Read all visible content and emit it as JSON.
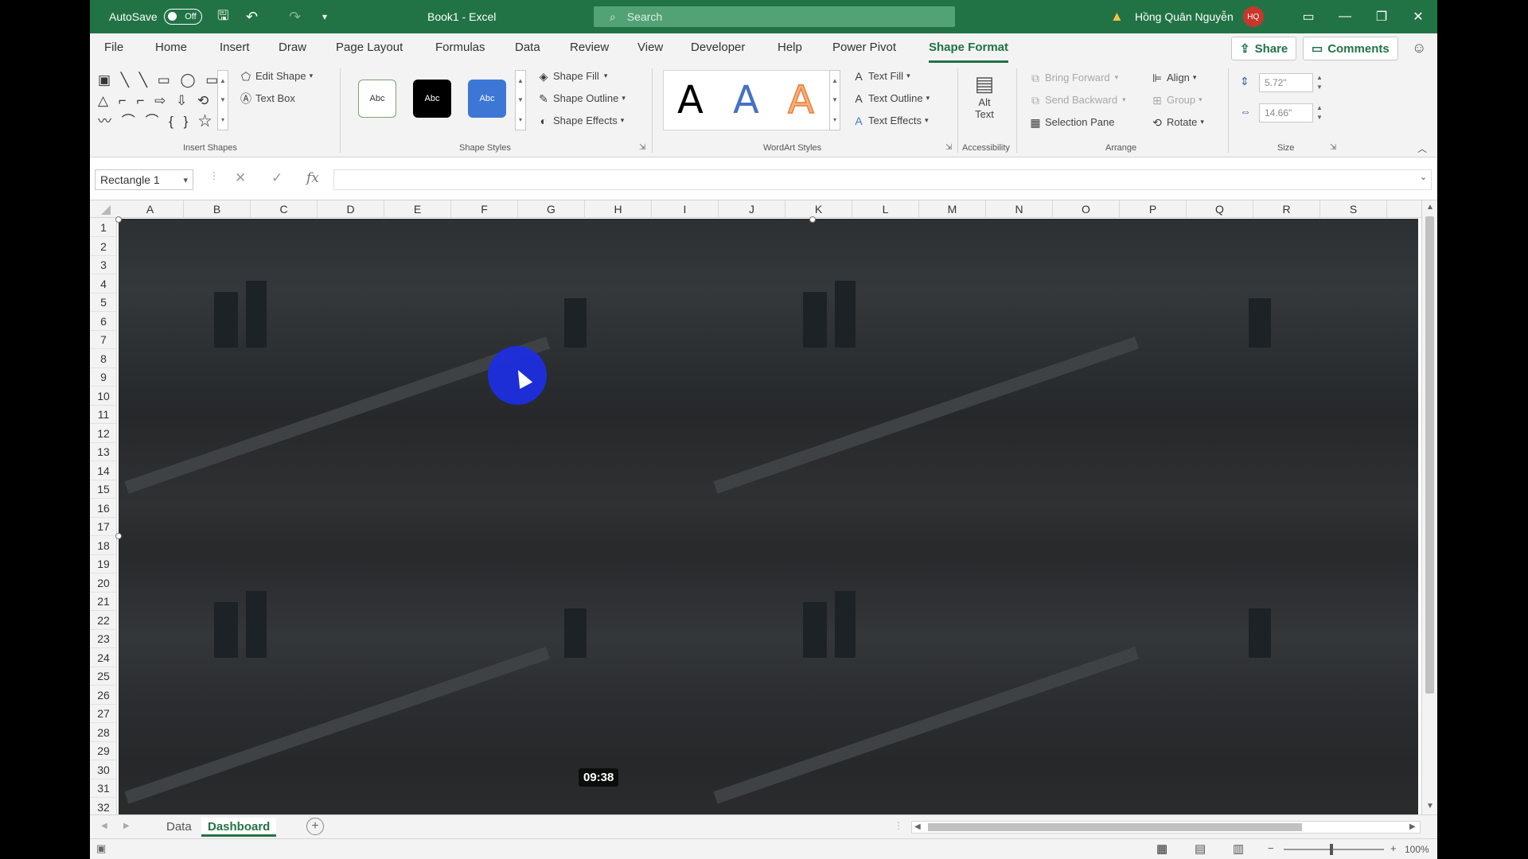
{
  "titlebar": {
    "autosave_label": "AutoSave",
    "autosave_state": "Off",
    "doc_title": "Book1 - Excel",
    "search_placeholder": "Search",
    "user_name": "Hồng Quân Nguyễn",
    "user_initials": "HQ"
  },
  "tabs": [
    "File",
    "Home",
    "Insert",
    "Draw",
    "Page Layout",
    "Formulas",
    "Data",
    "Review",
    "View",
    "Developer",
    "Help",
    "Power Pivot",
    "Shape Format"
  ],
  "active_tab": "Shape Format",
  "share_label": "Share",
  "comments_label": "Comments",
  "ribbon": {
    "insert_shapes": {
      "edit_shape": "Edit Shape",
      "text_box": "Text Box",
      "label": "Insert Shapes"
    },
    "shape_styles": {
      "sample": "Abc",
      "fill": "Shape Fill",
      "outline": "Shape Outline",
      "effects": "Shape Effects",
      "label": "Shape Styles"
    },
    "wordart": {
      "letter": "A",
      "text_fill": "Text Fill",
      "text_outline": "Text Outline",
      "text_effects": "Text Effects",
      "label": "WordArt Styles"
    },
    "accessibility": {
      "alt_text_1": "Alt",
      "alt_text_2": "Text",
      "label": "Accessibility"
    },
    "arrange": {
      "bring_forward": "Bring Forward",
      "send_backward": "Send Backward",
      "selection_pane": "Selection Pane",
      "align": "Align",
      "group": "Group",
      "rotate": "Rotate",
      "label": "Arrange"
    },
    "size": {
      "height": "5.72\"",
      "width": "14.66\"",
      "label": "Size"
    }
  },
  "formula_bar": {
    "name_box": "Rectangle 1",
    "fx": "fx"
  },
  "columns": [
    "A",
    "B",
    "C",
    "D",
    "E",
    "F",
    "G",
    "H",
    "I",
    "J",
    "K",
    "L",
    "M",
    "N",
    "O",
    "P",
    "Q",
    "R",
    "S"
  ],
  "rows": [
    "1",
    "2",
    "3",
    "4",
    "5",
    "6",
    "7",
    "8",
    "9",
    "10",
    "11",
    "12",
    "13",
    "14",
    "15",
    "16",
    "17",
    "18",
    "19",
    "20",
    "21",
    "22",
    "23",
    "24",
    "25",
    "26",
    "27",
    "28",
    "29",
    "30",
    "31",
    "32"
  ],
  "sheets": [
    "Data",
    "Dashboard"
  ],
  "active_sheet": "Dashboard",
  "video_timestamp": "09:38",
  "status": {
    "zoom": "100%"
  },
  "colors": {
    "excel_green": "#217346",
    "click_indicator": "#1c2ee0"
  }
}
